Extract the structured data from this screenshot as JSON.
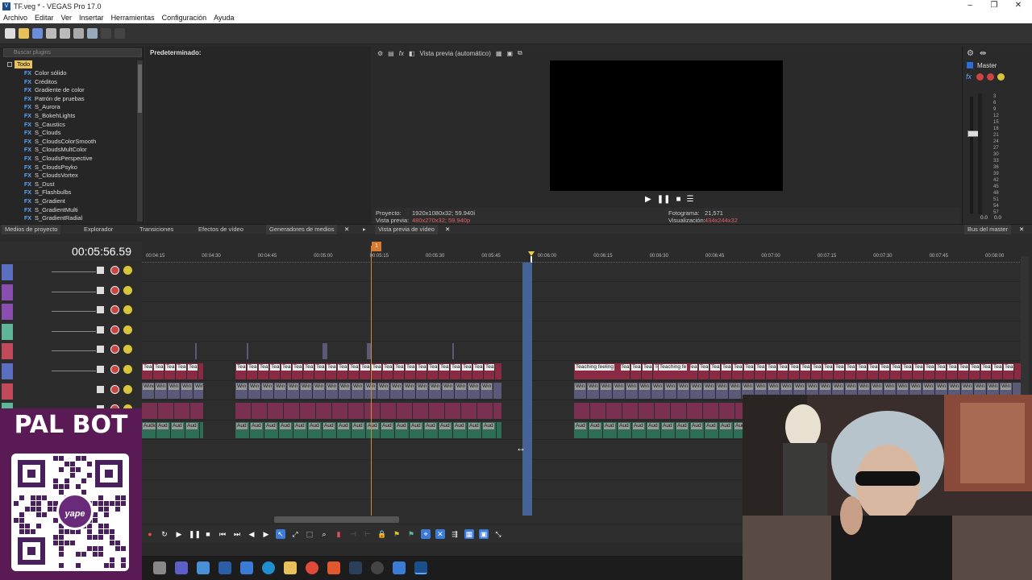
{
  "window": {
    "title": "TF.veg * - VEGAS Pro 17.0",
    "app_icon": "V"
  },
  "menu": [
    "Archivo",
    "Editar",
    "Ver",
    "Insertar",
    "Herramientas",
    "Configuración",
    "Ayuda"
  ],
  "plugins": {
    "search_placeholder": "Buscar plugins",
    "root": "Todo",
    "fx_badge": "FX",
    "items": [
      "Color sólido",
      "Créditos",
      "Gradiente de color",
      "Patrón de pruebas",
      "S_Aurora",
      "S_BokehLights",
      "S_Caustics",
      "S_Clouds",
      "S_CloudsColorSmooth",
      "S_CloudsMultColor",
      "S_CloudsPerspective",
      "S_CloudsPsyko",
      "S_CloudsVortex",
      "S_Dust",
      "S_Flashbulbs",
      "S_Gradient",
      "S_GradientMulti",
      "S_GradientRadial"
    ],
    "preset_label": "Predeterminado:"
  },
  "preview": {
    "mode": "Vista previa (automático)",
    "proyecto_label": "Proyecto:",
    "proyecto_value": "1920x1080x32; 59.940i",
    "vista_label": "Vista previa:",
    "vista_value": "480x270x32; 59.940p",
    "fotograma_label": "Fotograma:",
    "fotograma_value": "21,571",
    "visual_label": "Visualización:",
    "visual_value": "434x244x32"
  },
  "master": {
    "label": "Master",
    "db_ticks": [
      "3",
      "6",
      "9",
      "12",
      "15",
      "18",
      "21",
      "24",
      "27",
      "30",
      "33",
      "36",
      "39",
      "42",
      "45",
      "48",
      "51",
      "54",
      "57"
    ],
    "bottom_left": "0.0",
    "bottom_right": "0.0"
  },
  "tabs": {
    "medios": "Medios de proyecto",
    "explorador": "Explorador",
    "transiciones": "Transiciones",
    "efectos": "Efectos de vídeo",
    "generadores": "Generadores de medios",
    "vista_previa": "Vista previa de vídeo",
    "bus": "Bus del master"
  },
  "timeline": {
    "timecode": "00:05:56.59",
    "marker": "1",
    "ruler": [
      "00:04:15",
      "00:04:30",
      "00:04:45",
      "00:05:00",
      "00:05:15",
      "00:05:30",
      "00:05:45",
      "00:06:00",
      "00:06:15",
      "00:06:30",
      "00:06:45",
      "00:07:00",
      "00:07:15",
      "00:07:30",
      "00:07:45",
      "00:08:00"
    ],
    "track_colors": [
      "#5b6fc0",
      "#8a4db0",
      "#8a4db0",
      "#5fb59a",
      "#c04a5a",
      "#5b6fc0",
      "#c04a5a",
      "#5fb59a"
    ],
    "clip_labels": {
      "tea": "Tea",
      "teaching": "Teaching",
      "teaching_feeling": "Teaching feeling",
      "teaching_fe": "Teaching fe",
      "win": "Win",
      "window": "Window",
      "aud": "Aud",
      "audio": "Audio"
    }
  },
  "overlay": {
    "title": "PAL BOT",
    "qr_logo": "yape"
  },
  "colors": {
    "accent_orange": "#d97a2f",
    "loop_blue": "#4a6fa8",
    "panel_bg": "#2b2b2b"
  }
}
